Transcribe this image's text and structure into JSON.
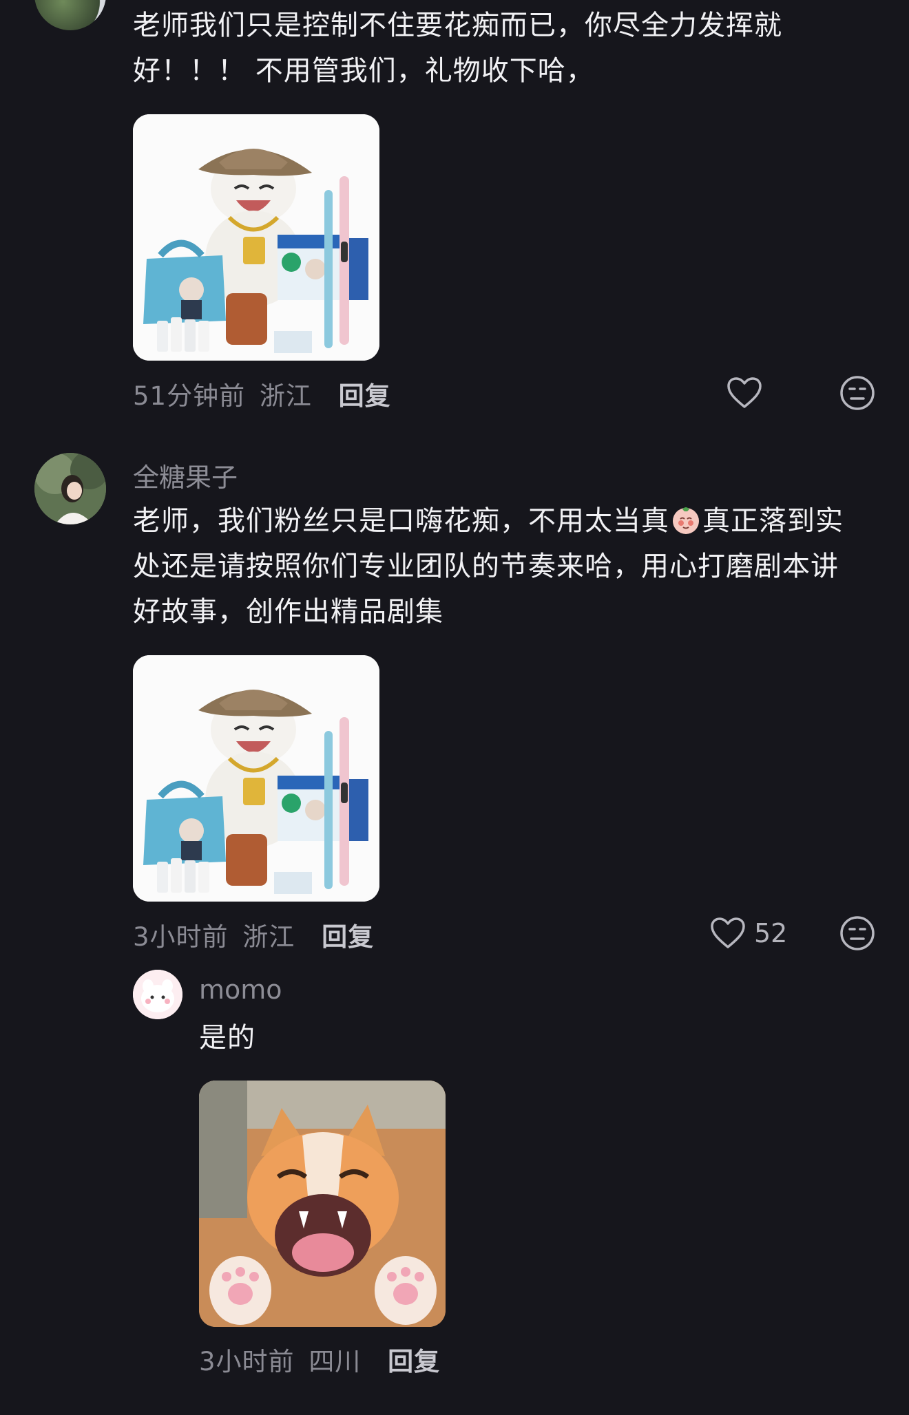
{
  "comments": [
    {
      "text_line1": "老师我们只是控制不住要花痴而已，你尽全力发挥就",
      "text_line2": "好！！！ 不用管我们，礼物收下哈，",
      "time": "51分钟前",
      "location": "浙江",
      "reply_label": "回复"
    },
    {
      "username": "全糖果子",
      "text_line1a": "老师，我们粉丝只是口嗨花痴，不用太当真",
      "text_line1b": "真正落到实",
      "text_line2": "处还是请按照你们专业团队的节奏来哈，用心打磨剧本讲",
      "text_line3": "好故事，创作出精品剧集",
      "time": "3小时前",
      "location": "浙江",
      "reply_label": "回复",
      "like_count": "52"
    }
  ],
  "reply": {
    "username": "momo",
    "text": "是的",
    "time": "3小时前",
    "location": "四川",
    "reply_label": "回复"
  },
  "icons": {
    "like": "heart-outline-icon",
    "dislike": "neutral-face-icon",
    "emoji": "blushing-face-emoji"
  }
}
